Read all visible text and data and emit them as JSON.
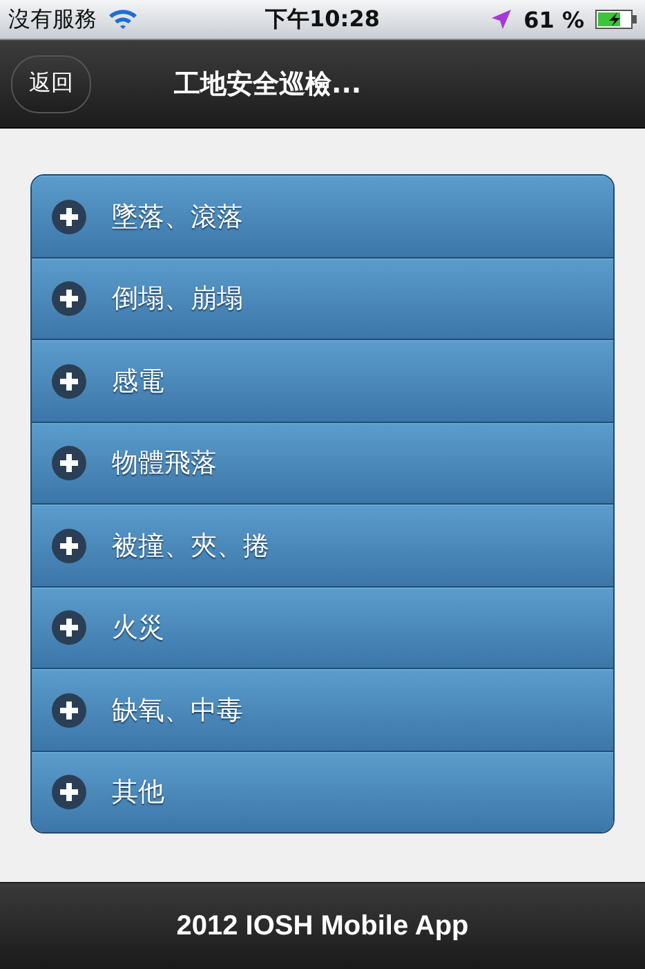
{
  "status_bar": {
    "carrier": "沒有服務",
    "time": "下午10:28",
    "battery": "61 %"
  },
  "header": {
    "back_button": "返回",
    "title": "工地安全巡檢..."
  },
  "sections": [
    {
      "label": "墜落、滾落",
      "expanded": false
    },
    {
      "label": "倒塌、崩塌",
      "expanded": false
    },
    {
      "label": "感電",
      "expanded": false
    },
    {
      "label": "物體飛落",
      "expanded": false
    },
    {
      "label": "被撞、夾、捲",
      "expanded": false
    },
    {
      "label": "火災",
      "expanded": false
    },
    {
      "label": "缺氧、中毒",
      "expanded": false
    },
    {
      "label": "其他",
      "expanded": false
    }
  ],
  "footer": {
    "text": "2012 IOSH Mobile App"
  }
}
